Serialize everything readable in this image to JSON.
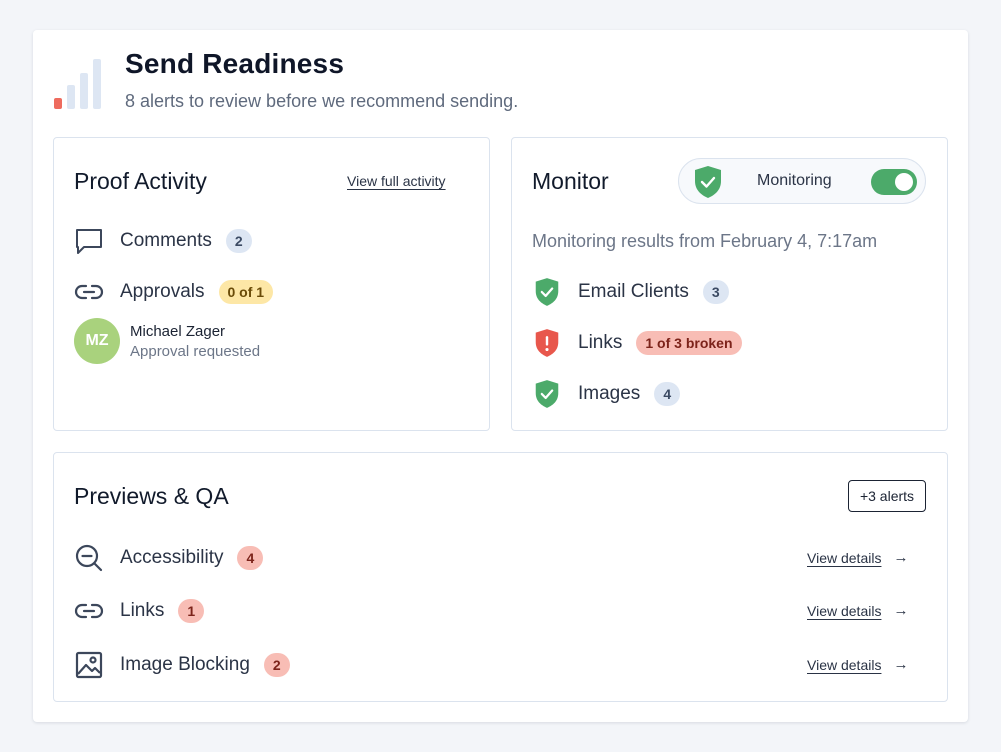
{
  "header": {
    "title": "Send Readiness",
    "subtitle": "8 alerts to review before we recommend sending.",
    "icon": "signal-bars-icon"
  },
  "proof_activity": {
    "title": "Proof Activity",
    "view_link": "View full activity",
    "comments": {
      "label": "Comments",
      "count": "2",
      "icon": "comment-icon"
    },
    "approvals": {
      "label": "Approvals",
      "status": "0 of 1",
      "icon": "link-icon"
    },
    "approver": {
      "initials": "MZ",
      "name": "Michael Zager",
      "status": "Approval requested"
    }
  },
  "monitor": {
    "title": "Monitor",
    "toggle_label": "Monitoring",
    "toggle_on": true,
    "results_text": "Monitoring results from February 4, 7:17am",
    "items": [
      {
        "label": "Email Clients",
        "badge": "3",
        "status": "ok",
        "icon": "shield-check-icon"
      },
      {
        "label": "Links",
        "badge": "1 of 3 broken",
        "status": "error",
        "icon": "shield-alert-icon"
      },
      {
        "label": "Images",
        "badge": "4",
        "status": "ok",
        "icon": "shield-check-icon"
      }
    ]
  },
  "previews": {
    "title": "Previews & QA",
    "alerts_button": "+3 alerts",
    "items": [
      {
        "label": "Accessibility",
        "badge": "4",
        "link": "View details",
        "icon": "zoom-out-icon"
      },
      {
        "label": "Links",
        "badge": "1",
        "link": "View details",
        "icon": "link-icon"
      },
      {
        "label": "Image Blocking",
        "badge": "2",
        "link": "View details",
        "icon": "image-icon"
      }
    ]
  },
  "colors": {
    "success": "#4caa6a",
    "error": "#e8574c",
    "accent_bar": "#ee6b5e"
  }
}
